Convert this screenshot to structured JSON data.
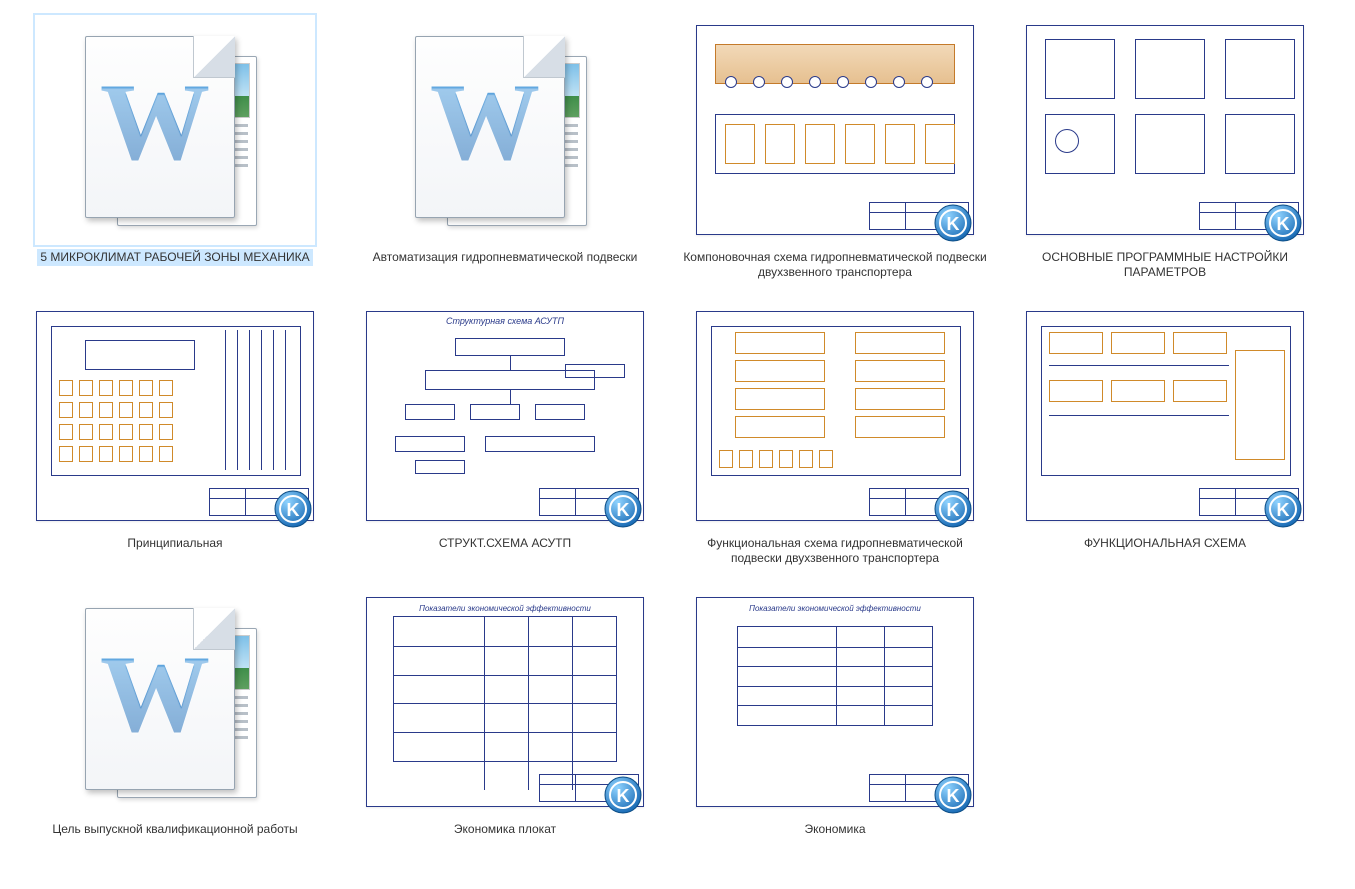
{
  "files": [
    {
      "type": "word",
      "label": "5 МИКРОКЛИМАТ РАБОЧЕЙ ЗОНЫ МЕХАНИКА",
      "selected": true,
      "badge": false
    },
    {
      "type": "word",
      "label": "Автоматизация гидропневматической подвески",
      "selected": false,
      "badge": false
    },
    {
      "type": "cad-compon",
      "label": "Компоновочная схема гидропневматической подвески двухзвенного транспортера",
      "selected": false,
      "badge": true
    },
    {
      "type": "cad-params",
      "label": "ОСНОВНЫЕ ПРОГРАММНЫЕ НАСТРОЙКИ ПАРАМЕТРОВ",
      "selected": false,
      "badge": true
    },
    {
      "type": "cad-princip",
      "label": "Принципиальная",
      "selected": false,
      "badge": true
    },
    {
      "type": "cad-struct",
      "label": "СТРУКТ.СХЕМА АСУТП",
      "selected": false,
      "badge": true,
      "title": "Структурная схема АСУТП"
    },
    {
      "type": "cad-func1",
      "label": "Функциональная схема  гидропневматической подвески двухзвенного транспортера",
      "selected": false,
      "badge": true
    },
    {
      "type": "cad-func2",
      "label": "ФУНКЦИОНАЛЬНАЯ СХЕМА",
      "selected": false,
      "badge": true
    },
    {
      "type": "word",
      "label": "Цель выпускной квалификационной работы",
      "selected": false,
      "badge": false
    },
    {
      "type": "cad-table",
      "label": "Экономика плокат",
      "selected": false,
      "badge": true,
      "title": "Показатели экономической эффективности"
    },
    {
      "type": "cad-table2",
      "label": "Экономика",
      "selected": false,
      "badge": true,
      "title": "Показатели экономической эффективности"
    }
  ],
  "badge_letter": "K"
}
